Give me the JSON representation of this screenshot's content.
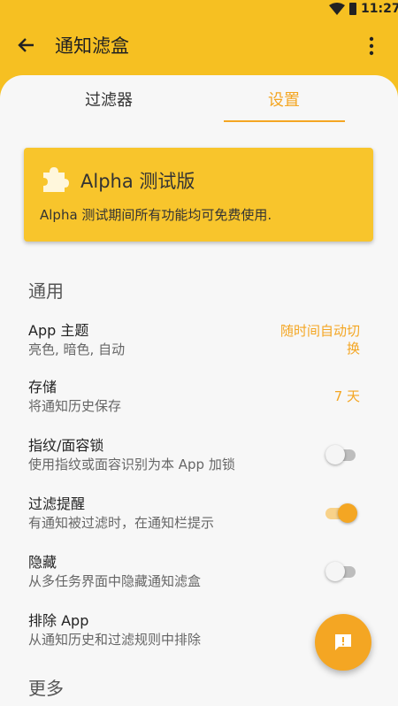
{
  "status_bar": {
    "time": "11:27"
  },
  "app_bar": {
    "title": "通知滤盒"
  },
  "tabs": [
    {
      "label": "过滤器",
      "selected": false
    },
    {
      "label": "设置",
      "selected": true
    }
  ],
  "alpha_card": {
    "title": "Alpha 测试版",
    "description": "Alpha 测试期间所有功能均可免费使用."
  },
  "sections": {
    "general": "通用",
    "more": "更多"
  },
  "settings": [
    {
      "title": "App 主题",
      "subtitle": "亮色, 暗色, 自动",
      "value": "随时间自动切换"
    },
    {
      "title": "存储",
      "subtitle": "将通知历史保存",
      "value": "7 天"
    },
    {
      "title": "指纹/面容锁",
      "subtitle": "使用指纹或面容识别为本 App 加锁",
      "switch_on": false
    },
    {
      "title": "过滤提醒",
      "subtitle": "有通知被过滤时，在通知栏提示",
      "switch_on": true
    },
    {
      "title": "隐藏",
      "subtitle": "从多任务界面中隐藏通知滤盒",
      "switch_on": false
    },
    {
      "title": "排除 App",
      "subtitle": "从通知历史和过滤规则中排除"
    }
  ],
  "colors": {
    "accent": "#f4a623",
    "app_bar": "#f6c022",
    "card": "#f8c52c"
  },
  "icons": {
    "back": "arrow-left",
    "more": "more-vertical",
    "alpha": "puzzle-piece",
    "fab": "feedback-message"
  }
}
